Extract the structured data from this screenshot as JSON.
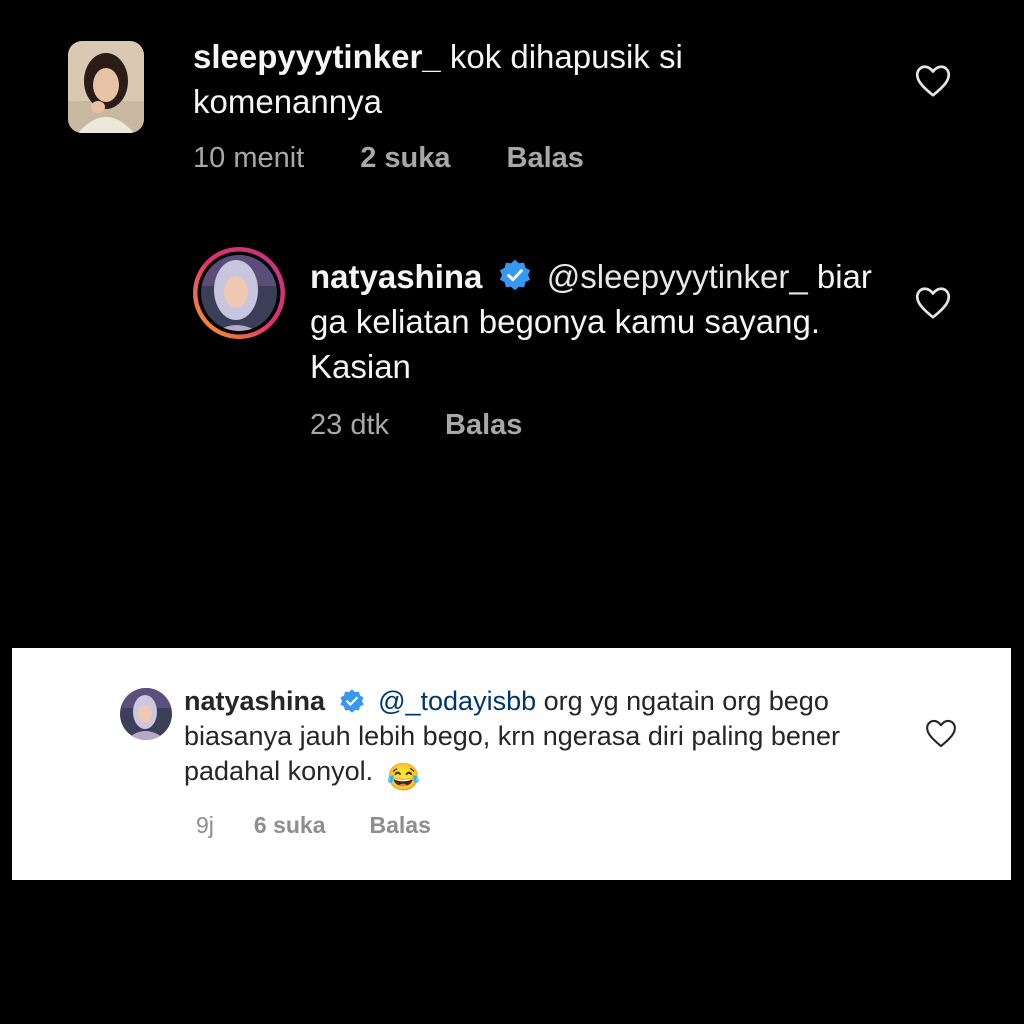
{
  "colors": {
    "dark_bg": "#000000",
    "light_bg": "#ffffff",
    "verified_blue": "#3897f0",
    "meta_gray_dark": "#a8a8a8",
    "meta_gray_light": "#8e8e8e",
    "mention_light": "#00376b"
  },
  "dark_comments": [
    {
      "username": "sleepyyytinker_",
      "text": "kok dihapusik si komenannya",
      "time": "10 menit",
      "likes": "2 suka",
      "reply": "Balas",
      "avatar_icon": "profile-photo-icon",
      "heart_icon": "heart-outline-icon"
    },
    {
      "username": "natyashina",
      "verified": true,
      "mention": "@sleepyyytinker_",
      "text": "biar ga keliatan begonya kamu sayang. Kasian",
      "time": "23 dtk",
      "reply": "Balas",
      "avatar_icon": "story-ring-avatar-icon",
      "heart_icon": "heart-outline-icon"
    }
  ],
  "light_comment": {
    "username": "natyashina",
    "verified": true,
    "mention": "@_todayisbb",
    "text": "org yg ngatain org bego biasanya jauh lebih bego, krn ngerasa diri paling bener padahal konyol.",
    "emoji": "😂",
    "time": "9j",
    "likes": "6 suka",
    "reply": "Balas",
    "avatar_icon": "profile-photo-icon",
    "heart_icon": "heart-outline-icon"
  }
}
